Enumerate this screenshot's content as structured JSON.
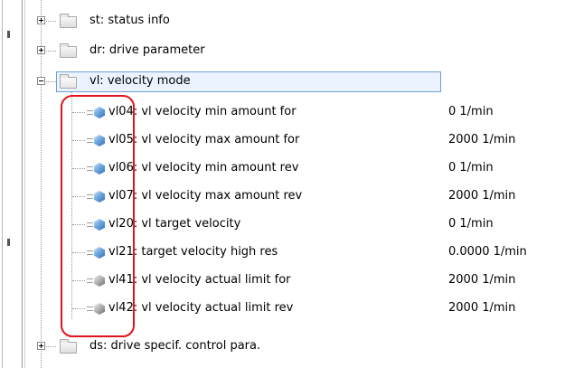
{
  "tree": {
    "groups": [
      {
        "key": "st",
        "label": "st: status info",
        "expanded": false
      },
      {
        "key": "dr",
        "label": "dr: drive parameter",
        "expanded": false
      },
      {
        "key": "vl",
        "label": "vl: velocity mode",
        "expanded": true,
        "selected": true
      },
      {
        "key": "ds",
        "label": "ds: drive specif. control para.",
        "expanded": false
      }
    ],
    "params": [
      {
        "label": "vl04: vl velocity min amount for",
        "value": "0 1/min",
        "icon": "blue-cube-icon"
      },
      {
        "label": "vl05: vl velocity max amount for",
        "value": "2000 1/min",
        "icon": "blue-cube-icon"
      },
      {
        "label": "vl06: vl velocity min amount rev",
        "value": "0 1/min",
        "icon": "blue-cube-icon"
      },
      {
        "label": "vl07: vl velocity max amount rev",
        "value": "2000 1/min",
        "icon": "blue-cube-icon"
      },
      {
        "label": "vl20: vl target velocity",
        "value": "0 1/min",
        "icon": "blue-cube-icon"
      },
      {
        "label": "vl21: target velocity high res",
        "value": "0.0000 1/min",
        "icon": "blue-cube-icon"
      },
      {
        "label": "vl41: vl velocity actual limit for",
        "value": "2000 1/min",
        "icon": "gray-cube-icon"
      },
      {
        "label": "vl42: vl velocity actual limit rev",
        "value": "2000 1/min",
        "icon": "gray-cube-icon"
      }
    ]
  },
  "colors": {
    "selection_border": "#6f9ed8",
    "selection_fill": "#eaf3ff",
    "annotation_red": "#e2141b",
    "cube_blue": "#4a8bd0",
    "cube_gray": "#9a9a9a"
  }
}
